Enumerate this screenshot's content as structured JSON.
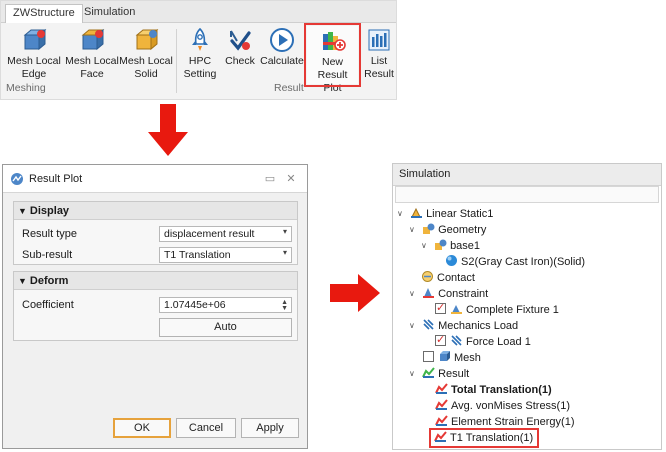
{
  "ribbon": {
    "tabs": [
      "ZWStructure",
      "Simulation"
    ],
    "buttons": [
      {
        "label1": "Mesh Local",
        "label2": "Edge",
        "icon": "mesh-edge-icon"
      },
      {
        "label1": "Mesh Local",
        "label2": "Face",
        "icon": "mesh-face-icon"
      },
      {
        "label1": "Mesh Local",
        "label2": "Solid",
        "icon": "mesh-solid-icon"
      },
      {
        "label1": "HPC",
        "label2": "Setting",
        "icon": "rocket-icon"
      },
      {
        "label1": "Check",
        "label2": "",
        "icon": "check-icon"
      },
      {
        "label1": "Calculate",
        "label2": "",
        "icon": "play-icon"
      },
      {
        "label1": "New Result",
        "label2": "Plot",
        "icon": "new-result-plot-icon"
      },
      {
        "label1": "List",
        "label2": "Result",
        "icon": "list-result-icon"
      }
    ],
    "groups": [
      "Meshing",
      "Result"
    ]
  },
  "dialog": {
    "title": "Result Plot",
    "display_header": "Display",
    "result_type_label": "Result type",
    "result_type_value": "displacement result",
    "sub_result_label": "Sub-result",
    "sub_result_value": "T1 Translation",
    "deform_header": "Deform",
    "coefficient_label": "Coefficient",
    "coefficient_value": "1.07445e+06",
    "auto_label": "Auto",
    "ok_label": "OK",
    "cancel_label": "Cancel",
    "apply_label": "Apply"
  },
  "panel": {
    "title": "Simulation",
    "tree": [
      {
        "label": "Linear Static1"
      },
      {
        "label": "Geometry"
      },
      {
        "label": "base1"
      },
      {
        "label": "S2(Gray Cast Iron)(Solid)"
      },
      {
        "label": "Contact"
      },
      {
        "label": "Constraint"
      },
      {
        "label": "Complete Fixture 1"
      },
      {
        "label": "Mechanics Load"
      },
      {
        "label": "Force Load 1"
      },
      {
        "label": "Mesh"
      },
      {
        "label": "Result"
      },
      {
        "label": "Total Translation(1)"
      },
      {
        "label": "Avg. vonMises Stress(1)"
      },
      {
        "label": "Element Strain Energy(1)"
      },
      {
        "label": "T1 Translation(1)"
      }
    ]
  },
  "colors": {
    "highlight": "#e53935",
    "arrow": "#e8190f"
  }
}
